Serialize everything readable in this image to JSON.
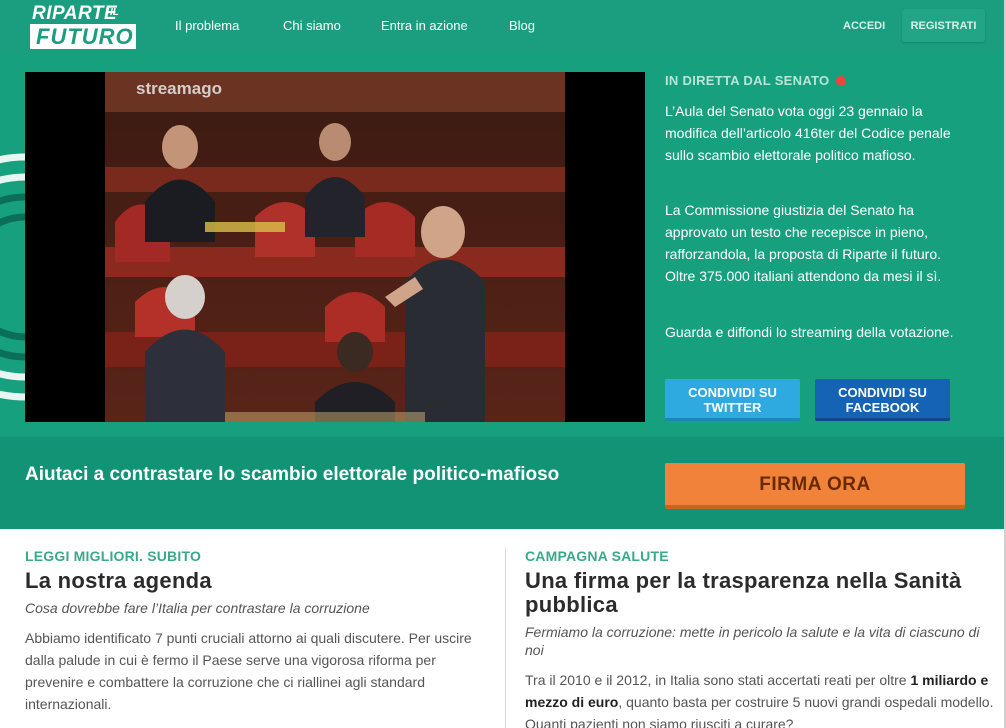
{
  "header": {
    "logo": {
      "line1": "RIPARTE",
      "il": "IL",
      "line2": "FUTURO"
    },
    "nav": [
      "Il problema",
      "Chi siamo",
      "Entra in azione",
      "Blog"
    ],
    "login_label": "ACCEDI",
    "register_label": "REGISTRATI"
  },
  "hero": {
    "video_watermark": "streamago",
    "live_label": "IN DIRETTA DAL SENATO",
    "paragraphs": [
      "L’Aula del Senato vota oggi 23 gennaio la modifica dell’articolo 416ter del Codice penale sullo scambio elettorale politico mafioso.",
      "La Commissione giustizia del Senato ha approvato un testo che recepisce in pieno, rafforzandola, la proposta di Riparte il futuro. Oltre 375.000 italiani attendono da mesi il sì.",
      "Guarda e diffondi lo streaming della votazione."
    ],
    "share_twitter": {
      "line1": "CONDIVIDI SU",
      "line2": "TWITTER"
    },
    "share_facebook": {
      "line1": "CONDIVIDI SU",
      "line2": "FACEBOOK"
    }
  },
  "cta": {
    "text": "Aiutaci a contrastare lo scambio elettorale politico-mafioso",
    "button_label": "FIRMA ORA"
  },
  "articles": [
    {
      "kicker": "LEGGI MIGLIORI. SUBITO",
      "title": "La nostra agenda",
      "subtitle": "Cosa dovrebbe fare l’Italia per contrastare la corruzione",
      "body": "Abbiamo identificato 7 punti cruciali attorno ai quali discutere. Per uscire dalla palude in cui è fermo il Paese serve una vigorosa riforma per prevenire e combattere la corruzione che ci riallinei agli standard internazionali."
    },
    {
      "kicker": "CAMPAGNA SALUTE",
      "title": "Una firma per la trasparenza nella Sanità pubblica",
      "subtitle": "Fermiamo la corruzione: mette in pericolo la salute e la vita di ciascuno di noi",
      "body_prefix": "Tra il 2010 e il 2012, in Italia sono stati accertati reati per oltre ",
      "body_bold": "1 miliardo e mezzo di euro",
      "body_suffix": ", quanto basta per costruire 5 nuovi grandi ospedali modello. Quanti pazienti non siamo riusciti a curare?"
    }
  ],
  "colors": {
    "brand_green": "#1a9e7f",
    "hero_green": "#17a07e",
    "cta_green": "#139376",
    "orange": "#f0823a",
    "twitter_blue": "#2eaae1",
    "facebook_blue": "#1563b5",
    "live_red": "#e8473c"
  }
}
